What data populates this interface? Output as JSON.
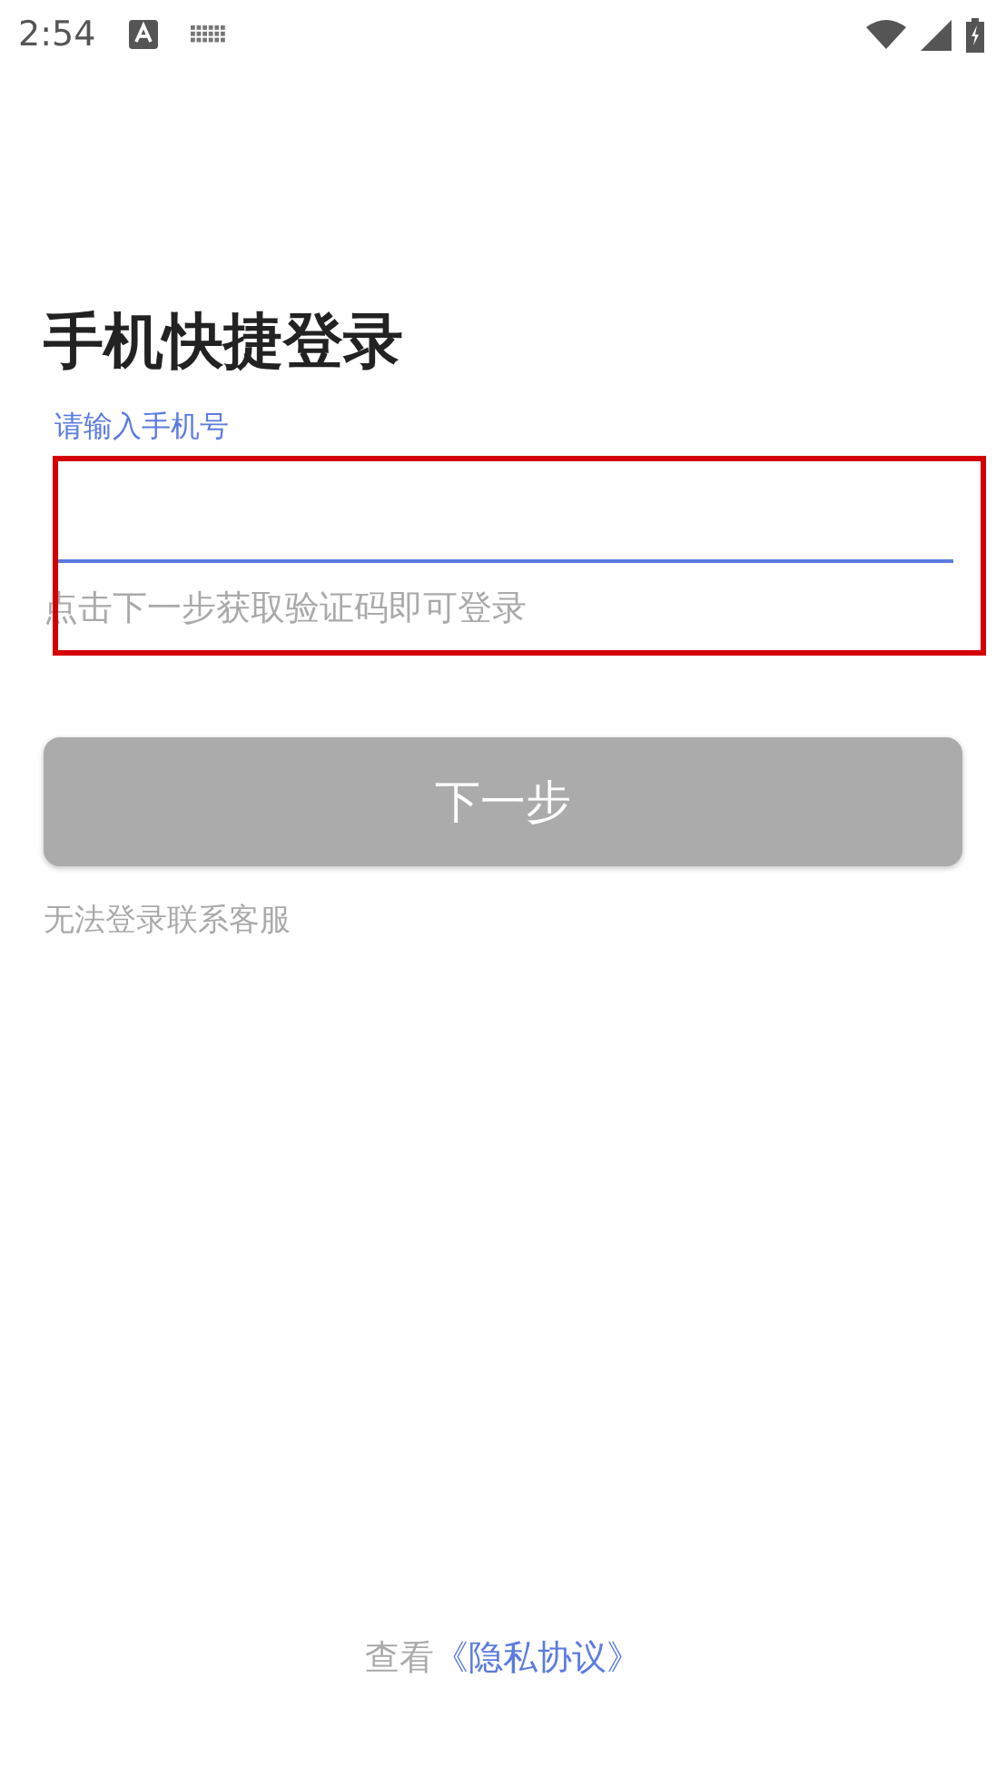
{
  "status_bar": {
    "time": "2:54"
  },
  "title": "手机快捷登录",
  "phone_field": {
    "label": "请输入手机号",
    "highlighted": true
  },
  "hint": "点击下一步获取验证码即可登录",
  "next_button": {
    "label": "下一步",
    "disabled": true
  },
  "help_link": "无法登录联系客服",
  "privacy": {
    "prefix": "查看",
    "link": "《隐私协议》"
  }
}
